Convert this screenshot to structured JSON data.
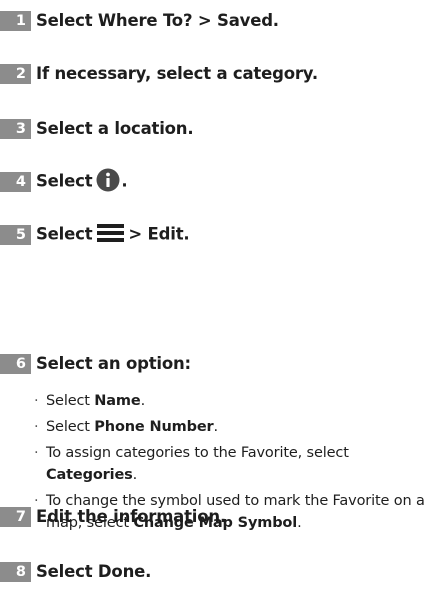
{
  "steps": [
    {
      "num": "1",
      "text": "Select Where To? > Saved."
    },
    {
      "num": "2",
      "text": "If necessary, select a category."
    },
    {
      "num": "3",
      "text": "Select a location."
    },
    {
      "num": "4",
      "text": "Select",
      "suffix": ".",
      "icon": "info-icon"
    },
    {
      "num": "5",
      "text": "Select",
      "suffix": "> Edit.",
      "icon": "menu-icon"
    },
    {
      "num": "6",
      "text": "Select an option:"
    },
    {
      "num": "7",
      "text": "Edit the information."
    },
    {
      "num": "8",
      "text": "Select Done."
    }
  ],
  "options": [
    {
      "prefix": "Select ",
      "bold": "Name",
      "suffix": "."
    },
    {
      "prefix": "Select ",
      "bold": "Phone Number",
      "suffix": "."
    },
    {
      "prefix": "To assign categories to the Favorite, select ",
      "bold": "Categories",
      "suffix": "."
    },
    {
      "prefix": "To change the symbol used to mark the Favorite on a map, select ",
      "bold": "Change Map Symbol",
      "suffix": "."
    }
  ],
  "bullet_char": "·",
  "colors": {
    "number_badge": "#8c8c8c",
    "text": "#1e1e1e"
  }
}
